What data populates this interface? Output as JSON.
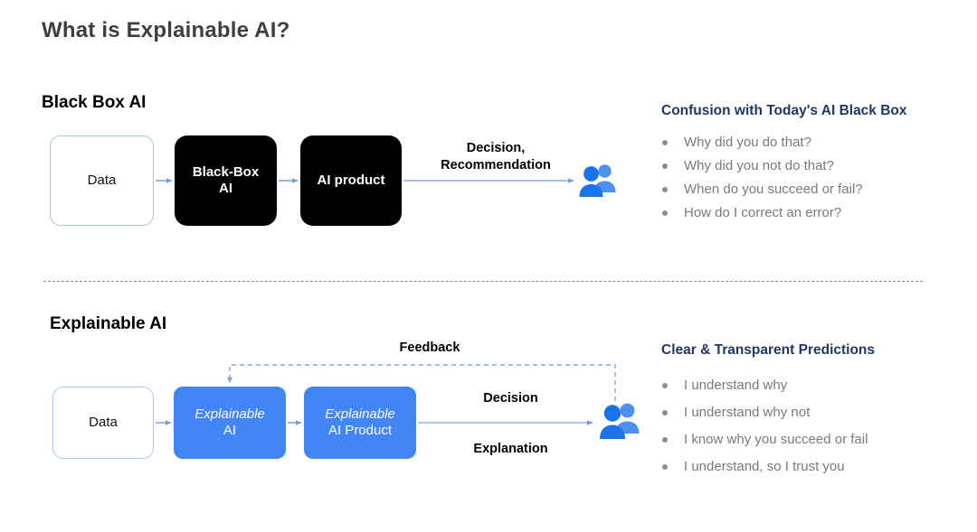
{
  "slide": {
    "title": "What is Explainable AI?"
  },
  "sections": {
    "blackbox": {
      "heading": "Black Box AI",
      "boxes": {
        "data": "Data",
        "model_line1": "Black-Box",
        "model_line2": "AI",
        "product": "AI product"
      },
      "flow_label": "Decision,\nRecommendation",
      "flow_label_line1": "Decision,",
      "flow_label_line2": "Recommendation",
      "panel": {
        "title": "Confusion with Today's AI Black Box",
        "bullets": [
          "Why did you do that?",
          "Why did you not do that?",
          "When do you succeed or fail?",
          "How do I correct an error?"
        ]
      }
    },
    "explainable": {
      "heading": "Explainable AI",
      "boxes": {
        "data": "Data",
        "model_line1": "Explainable",
        "model_line2": "AI",
        "product_line1": "Explainable",
        "product_line2": "AI Product"
      },
      "labels": {
        "feedback": "Feedback",
        "decision": "Decision",
        "explanation": "Explanation"
      },
      "panel": {
        "title": "Clear & Transparent Predictions",
        "bullets": [
          "I understand why",
          "I understand why not",
          "I know why you succeed or fail",
          "I understand, so I trust you"
        ]
      }
    }
  },
  "colors": {
    "title_text": "#3c4043",
    "panel_title": "#1f3864",
    "bullet_text": "#7a7a7a",
    "blue_box": "#4285f4",
    "black_box": "#000000",
    "data_box_border": "#a8c7f0",
    "arrow": "#7aa3e0",
    "dashed_divider": "#8a8a8a",
    "people_front": "#1a73e8",
    "people_back": "#4d90f0"
  },
  "icons": {
    "people_top": "people-icon",
    "people_bottom": "people-icon"
  }
}
